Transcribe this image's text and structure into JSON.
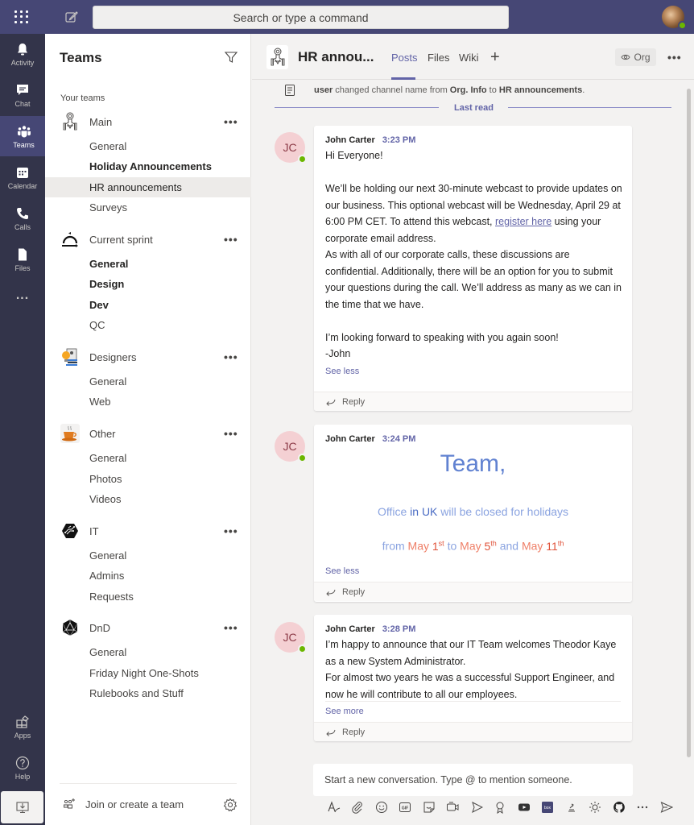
{
  "topbar": {
    "search_placeholder": "Search or type a command",
    "icons": [
      "app-launcher-icon",
      "compose-icon"
    ],
    "user_presence": "available"
  },
  "rail": {
    "items": [
      {
        "label": "Activity",
        "icon": "bell-icon"
      },
      {
        "label": "Chat",
        "icon": "chat-icon"
      },
      {
        "label": "Teams",
        "icon": "teams-icon",
        "active": true
      },
      {
        "label": "Calendar",
        "icon": "calendar-icon"
      },
      {
        "label": "Calls",
        "icon": "phone-icon"
      },
      {
        "label": "Files",
        "icon": "file-icon"
      },
      {
        "label": "...",
        "icon": "more-icon"
      }
    ],
    "bottom": [
      {
        "label": "Apps",
        "icon": "apps-icon"
      },
      {
        "label": "Help",
        "icon": "help-icon"
      }
    ],
    "download_icon": "download-icon"
  },
  "teams_panel": {
    "title": "Teams",
    "section_label": "Your teams",
    "teams": [
      {
        "name": "Main",
        "icon": "starship-icon",
        "channels": [
          {
            "name": "General",
            "bold": false
          },
          {
            "name": "Holiday Announcements",
            "bold": true
          },
          {
            "name": "HR announcements",
            "selected": true
          },
          {
            "name": "Surveys",
            "bold": false
          }
        ]
      },
      {
        "name": "Current sprint",
        "icon": "cycle-icon",
        "channels": [
          {
            "name": "General",
            "bold": true
          },
          {
            "name": "Design",
            "bold": true
          },
          {
            "name": "Dev",
            "bold": true
          },
          {
            "name": "QC",
            "bold": false
          }
        ]
      },
      {
        "name": "Designers",
        "icon": "design-idea-icon",
        "channels": [
          {
            "name": "General"
          },
          {
            "name": "Web"
          }
        ]
      },
      {
        "name": "Other",
        "icon": "coffee-cup-icon",
        "channels": [
          {
            "name": "General"
          },
          {
            "name": "Photos"
          },
          {
            "name": "Videos"
          }
        ]
      },
      {
        "name": "IT",
        "icon": "circuit-icon",
        "channels": [
          {
            "name": "General"
          },
          {
            "name": "Admins"
          },
          {
            "name": "Requests"
          }
        ]
      },
      {
        "name": "DnD",
        "icon": "d20-dice-icon",
        "channels": [
          {
            "name": "General"
          },
          {
            "name": "Friday Night One-Shots"
          },
          {
            "name": "Rulebooks and Stuff"
          }
        ]
      }
    ],
    "more_label": "•••",
    "join_label": "Join or create a team"
  },
  "channel": {
    "title": "HR annou...",
    "tabs": [
      {
        "label": "Posts",
        "active": true
      },
      {
        "label": "Files"
      },
      {
        "label": "Wiki"
      }
    ],
    "add_tab": "+",
    "org_label": "Org",
    "more_label": "•••"
  },
  "feed": {
    "system_message": {
      "actor": "user",
      "text1": " changed channel name from ",
      "from": "Org. Info",
      "text2": " to ",
      "to": "HR announcements",
      "end": "."
    },
    "last_read": "Last read",
    "posts": [
      {
        "initials": "JC",
        "author": "John Carter",
        "time": "3:23 PM",
        "lines": {
          "greet": "Hi Everyone!",
          "p1a": "We’ll be holding our next 30-minute webcast to provide updates on our business.  This optional webcast will be Wednesday, April 29 at 6:00 PM CET.  To attend this webcast, ",
          "link": "register here",
          "p1b": " using your corporate email address.",
          "p2": "As with all of our corporate calls, these discussions are confidential.  Additionally, there will be an option for you to submit your questions during the call.  We’ll address as many as we can in the time that we have.",
          "p3": "I’m looking forward to speaking with you again soon!",
          "sign": "-John"
        },
        "toggle": "See less",
        "reply": "Reply"
      },
      {
        "initials": "JC",
        "author": "John Carter",
        "time": "3:24 PM",
        "headline": "Team,",
        "line1": {
          "a": "Office ",
          "b": "in UK",
          "c": " will be closed for holidays"
        },
        "line2": {
          "from": "from ",
          "may1": "May ",
          "d1": "1",
          "s1": "st",
          "to": " to ",
          "may2": "May ",
          "d2": "5",
          "s2": "th",
          "and": " and ",
          "may3": "May ",
          "d3": "11",
          "s3": "th"
        },
        "toggle": "See less",
        "reply": "Reply"
      },
      {
        "initials": "JC",
        "author": "John Carter",
        "time": "3:28 PM",
        "p1": "I’m happy to announce that our IT Team welcomes Theodor Kaye as a new System Administrator.",
        "p2": "For almost two years he was a successful Support Engineer, and now he will contribute to all our employees.",
        "toggle": "See more",
        "reply": "Reply"
      }
    ]
  },
  "compose": {
    "placeholder": "Start a new conversation. Type @ to mention someone.",
    "tools": [
      "format-icon",
      "attach-icon",
      "emoji-icon",
      "gif-icon",
      "sticker-icon",
      "meet-now-icon",
      "stream-icon",
      "praise-icon",
      "youtube-icon",
      "box-icon",
      "stack-icon",
      "weather-icon",
      "github-icon",
      "more-icon",
      "send-icon"
    ]
  },
  "colors": {
    "brand": "#6264a7",
    "topbar": "#464775",
    "rail": "#33344a",
    "presence": "#6bb700",
    "highlight_red": "#ef7f67",
    "highlight_blue": "#6182d1"
  }
}
